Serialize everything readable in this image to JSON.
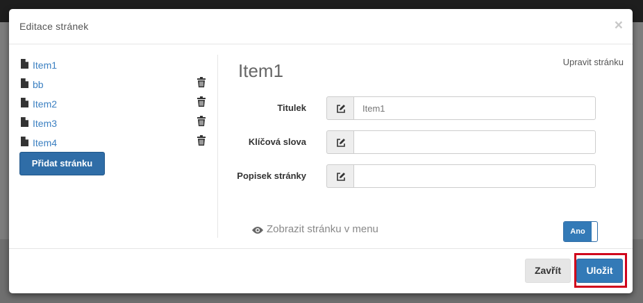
{
  "modal": {
    "title": "Editace stránek",
    "close_symbol": "×"
  },
  "pages": [
    {
      "label": "Item1",
      "icon": "file-icon"
    },
    {
      "label": "bb",
      "icon": "file-icon",
      "has_delete": true
    },
    {
      "label": "Item2",
      "icon": "file-icon",
      "has_delete": true
    },
    {
      "label": "Item3",
      "icon": "file-icon",
      "has_delete": true
    },
    {
      "label": "Item4",
      "icon": "file-icon",
      "has_delete": true
    }
  ],
  "add_page_label": "Přidat stránku",
  "editor": {
    "edit_link": "Upravit stránku",
    "heading": "Item1",
    "fields": [
      {
        "label": "Titulek",
        "value": "",
        "placeholder": "Item1",
        "icon": "edit-icon"
      },
      {
        "label": "Klíčová slova",
        "value": "",
        "placeholder": "",
        "icon": "edit-icon"
      },
      {
        "label": "Popisek stránky",
        "value": "",
        "placeholder": "",
        "icon": "edit-icon"
      }
    ],
    "menu_visibility": {
      "icon": "eye-icon",
      "label": "Zobrazit stránku v menu",
      "toggle_label": "Ano",
      "state": "on"
    }
  },
  "footer": {
    "close_label": "Zavřít",
    "save_label": "Uložit"
  },
  "colors": {
    "primary": "#337ab7",
    "link": "#3a7fc1",
    "highlight": "#d0021b"
  }
}
